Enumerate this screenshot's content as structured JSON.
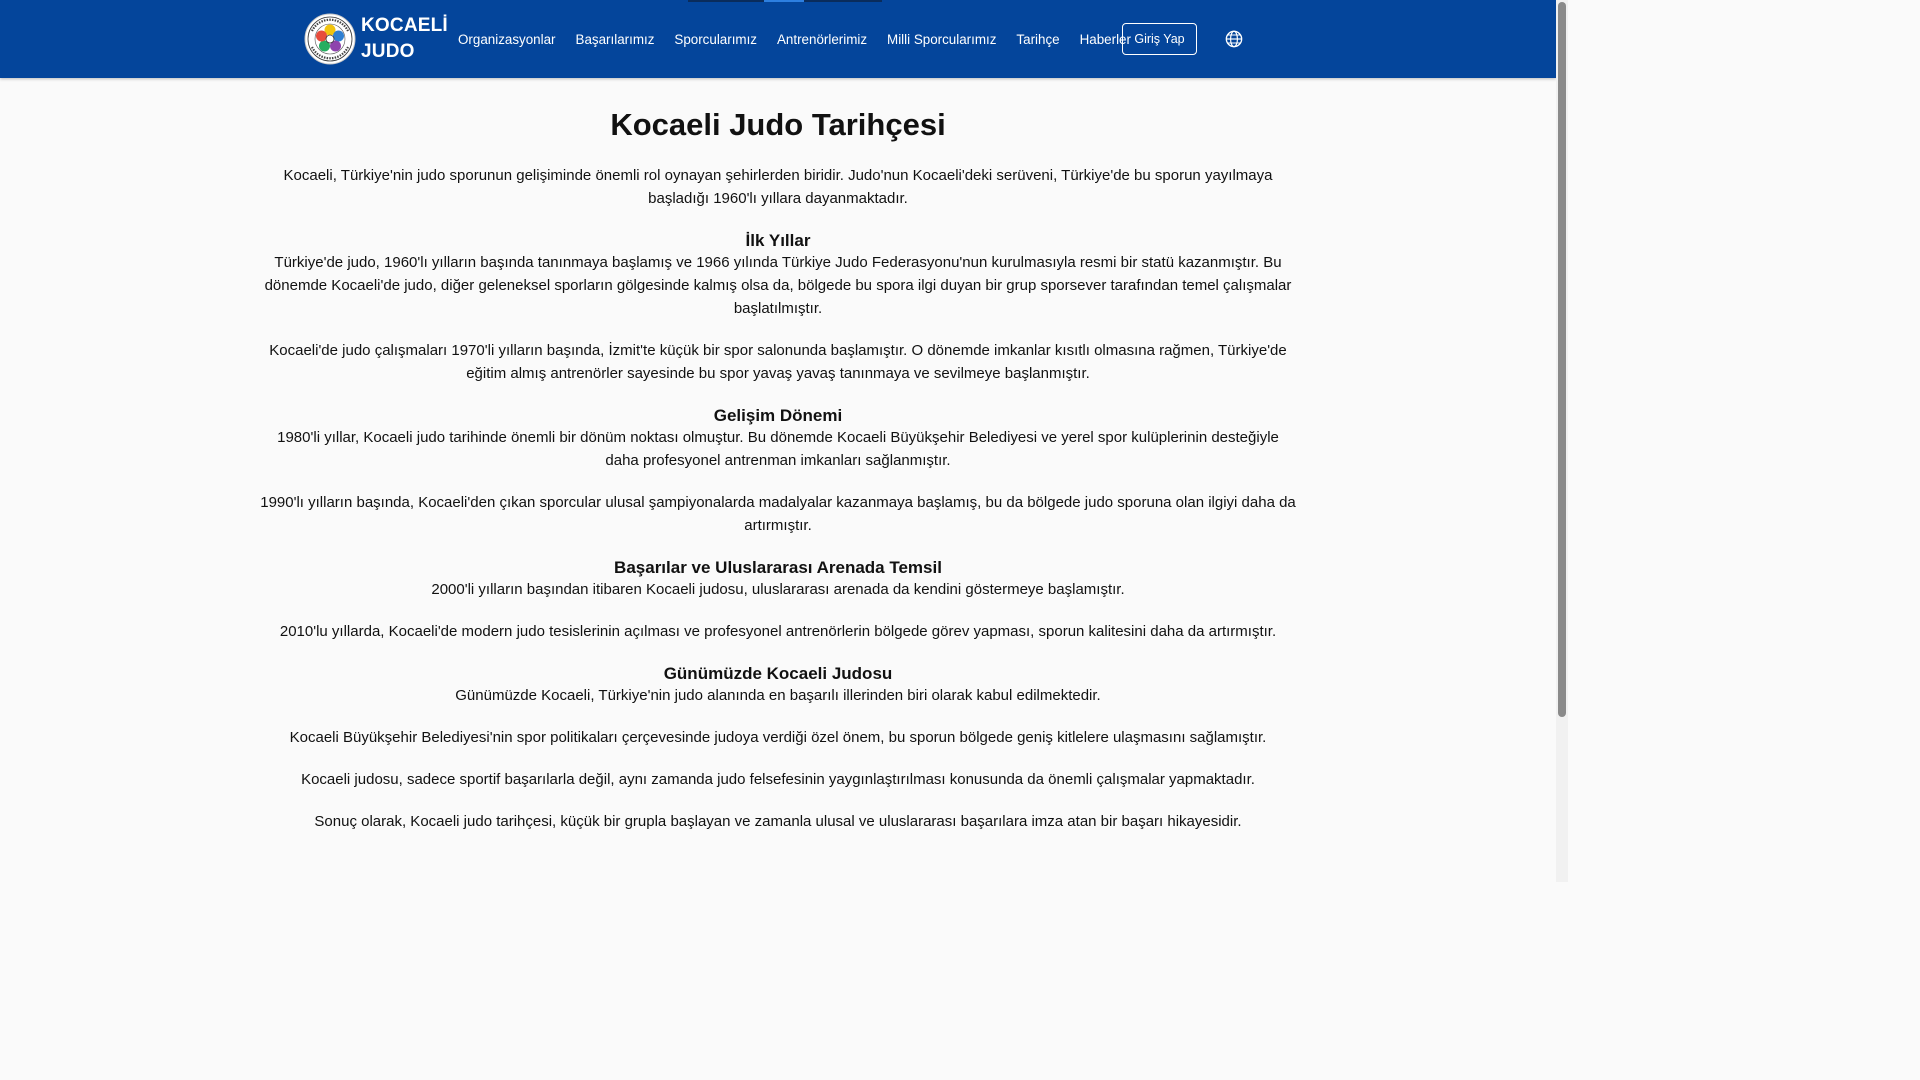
{
  "navbar": {
    "brand_line1": "KOCAELİ",
    "brand_line2": "JUDO",
    "links": [
      "Organizasyonlar",
      "Başarılarımız",
      "Sporcularımız",
      "Antrenörlerimiz",
      "Milli Sporcularımız",
      "Tarihçe",
      "Haberler"
    ],
    "login_label": "Giriş Yap",
    "language_icon": "globe-icon",
    "colors": {
      "background": "#04459b",
      "text": "#ffffff"
    }
  },
  "main": {
    "title": "Kocaeli Judo Tarihçesi",
    "intro": "Kocaeli, Türkiye'nin judo sporunun gelişiminde önemli rol oynayan şehirlerden biridir. Judo'nun Kocaeli'deki serüveni, Türkiye'de bu sporun yayılmaya başladığı 1960'lı yıllara dayanmaktadır.",
    "sections": [
      {
        "heading": "İlk Yıllar",
        "paragraphs": [
          "Türkiye'de judo, 1960'lı yılların başında tanınmaya başlamış ve 1966 yılında Türkiye Judo Federasyonu'nun kurulmasıyla resmi bir statü kazanmıştır. Bu dönemde Kocaeli'de judo, diğer geleneksel sporların gölgesinde kalmış olsa da, bölgede bu spora ilgi duyan bir grup sporsever tarafından temel çalışmalar başlatılmıştır.",
          "Kocaeli'de judo çalışmaları 1970'li yılların başında, İzmit'te küçük bir spor salonunda başlamıştır. O dönemde imkanlar kısıtlı olmasına rağmen, Türkiye'de eğitim almış antrenörler sayesinde bu spor yavaş yavaş tanınmaya ve sevilmeye başlanmıştır."
        ]
      },
      {
        "heading": "Gelişim Dönemi",
        "paragraphs": [
          "1980'li yıllar, Kocaeli judo tarihinde önemli bir dönüm noktası olmuştur. Bu dönemde Kocaeli Büyükşehir Belediyesi ve yerel spor kulüplerinin desteğiyle daha profesyonel antrenman imkanları sağlanmıştır.",
          "1990'lı yılların başında, Kocaeli'den çıkan sporcular ulusal şampiyonalarda madalyalar kazanmaya başlamış, bu da bölgede judo sporuna olan ilgiyi daha da artırmıştır."
        ]
      },
      {
        "heading": "Başarılar ve Uluslararası Arenada Temsil",
        "paragraphs": [
          "2000'li yılların başından itibaren Kocaeli judosu, uluslararası arenada da kendini göstermeye başlamıştır.",
          "2010'lu yıllarda, Kocaeli'de modern judo tesislerinin açılması ve profesyonel antrenörlerin bölgede görev yapması, sporun kalitesini daha da artırmıştır."
        ]
      },
      {
        "heading": "Günümüzde Kocaeli Judosu",
        "paragraphs": [
          "Günümüzde Kocaeli, Türkiye'nin judo alanında en başarılı illerinden biri olarak kabul edilmektedir.",
          "Kocaeli Büyükşehir Belediyesi'nin spor politikaları çerçevesinde judoya verdiği özel önem, bu sporun bölgede geniş kitlelere ulaşmasını sağlamıştır.",
          "Kocaeli judosu, sadece sportif başarılarla değil, aynı zamanda judo felsefesinin yaygınlaştırılması konusunda da önemli çalışmalar yapmaktadır.",
          "Sonuç olarak, Kocaeli judo tarihçesi, küçük bir grupla başlayan ve zamanla ulusal ve uluslararası başarılara imza atan bir başarı hikayesidir."
        ]
      }
    ]
  }
}
